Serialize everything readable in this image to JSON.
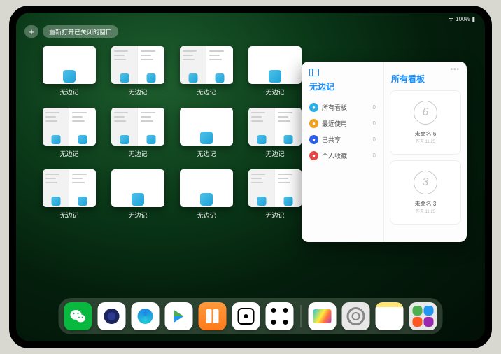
{
  "status": {
    "battery": "100%"
  },
  "toolbar": {
    "plus": "+",
    "reopen_label": "重新打开已关闭的窗口"
  },
  "windows": [
    {
      "label": "无边记",
      "style": "blank"
    },
    {
      "label": "无边记",
      "style": "content"
    },
    {
      "label": "无边记",
      "style": "content"
    },
    {
      "label": "无边记",
      "style": "blank"
    },
    {
      "label": "无边记",
      "style": "content"
    },
    {
      "label": "无边记",
      "style": "content"
    },
    {
      "label": "无边记",
      "style": "blank"
    },
    {
      "label": "无边记",
      "style": "content"
    },
    {
      "label": "无边记",
      "style": "content"
    },
    {
      "label": "无边记",
      "style": "blank"
    },
    {
      "label": "无边记",
      "style": "blank"
    },
    {
      "label": "无边记",
      "style": "content"
    }
  ],
  "panel": {
    "left_title": "无边记",
    "nav": [
      {
        "label": "所有看板",
        "count": "0",
        "color": "nb-blue"
      },
      {
        "label": "最近使用",
        "count": "0",
        "color": "nb-orange"
      },
      {
        "label": "已共享",
        "count": "0",
        "color": "nb-dblue"
      },
      {
        "label": "个人收藏",
        "count": "0",
        "color": "nb-red"
      }
    ],
    "right_title": "所有看板",
    "boards": [
      {
        "glyph": "6",
        "name": "未命名 6",
        "date": "昨天 11:25"
      },
      {
        "glyph": "3",
        "name": "未命名 3",
        "date": "昨天 11:25"
      }
    ]
  },
  "dock": {
    "apps": [
      {
        "name": "wechat"
      },
      {
        "name": "quark-hd"
      },
      {
        "name": "qq-browser"
      },
      {
        "name": "play"
      },
      {
        "name": "books"
      },
      {
        "name": "dice"
      },
      {
        "name": "connect-dots"
      },
      {
        "name": "freeform"
      },
      {
        "name": "settings"
      },
      {
        "name": "notes"
      },
      {
        "name": "app-library"
      }
    ]
  }
}
